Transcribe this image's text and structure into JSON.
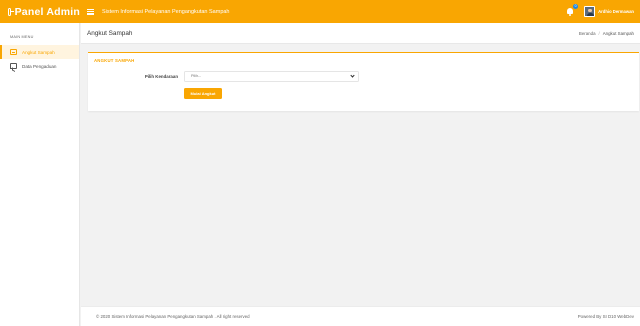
{
  "topbar": {
    "brand": "Panel Admin",
    "app_title": "Sistem Informasi Pelayanan Pengangkutan Sampah",
    "notification_count": "0",
    "username": "Ardhio Dermawan"
  },
  "sidebar": {
    "heading": "MAIN MENU",
    "items": [
      {
        "label": "Angkut Sampah",
        "icon": "truck-icon",
        "active": true
      },
      {
        "label": "Data Pengaduan",
        "icon": "message-icon",
        "active": false
      }
    ]
  },
  "header": {
    "page_title": "Angkut Sampah",
    "breadcrumb": [
      "Beranda",
      "Angkut Sampah"
    ],
    "breadcrumb_separator": "/"
  },
  "card": {
    "heading": "ANGKUT SAMPAH",
    "field_label": "Pilih Kendaraan",
    "select_value": "Pilih--",
    "submit_label": "Mulai Angkut"
  },
  "footer": {
    "left": "© 2020 Sistem Informasi Pelayanan Pengangkutan Sampah . All right reserved",
    "right": "Powered By SI D10 WebDev"
  },
  "colors": {
    "accent": "#f9a602",
    "badge": "#1e88e5"
  }
}
